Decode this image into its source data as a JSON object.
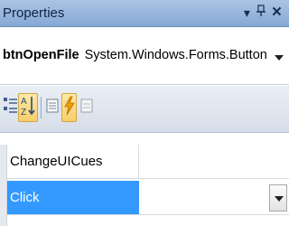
{
  "window": {
    "title": "Properties",
    "controls": {
      "dropdown_icon": "dropdown-arrow-icon",
      "pin_icon": "pin-icon",
      "close_icon": "close-icon"
    }
  },
  "object_selector": {
    "name": "btnOpenFile",
    "type": "System.Windows.Forms.Button"
  },
  "toolbar": {
    "buttons": [
      {
        "icon": "categorized-icon",
        "pressed": false
      },
      {
        "icon": "alphabetical-icon",
        "pressed": true
      },
      {
        "icon": "properties-icon",
        "pressed": false
      },
      {
        "icon": "events-lightning-icon",
        "pressed": true
      },
      {
        "icon": "property-pages-icon",
        "pressed": false
      }
    ]
  },
  "grid": {
    "rows": [
      {
        "name": "ChangeUICues",
        "value": "",
        "selected": false
      },
      {
        "name": "Click",
        "value": "",
        "selected": true
      }
    ]
  },
  "colors": {
    "title_bar": "#9cb8de",
    "selection": "#3399ff",
    "pressed_button": "#f9d67a"
  }
}
